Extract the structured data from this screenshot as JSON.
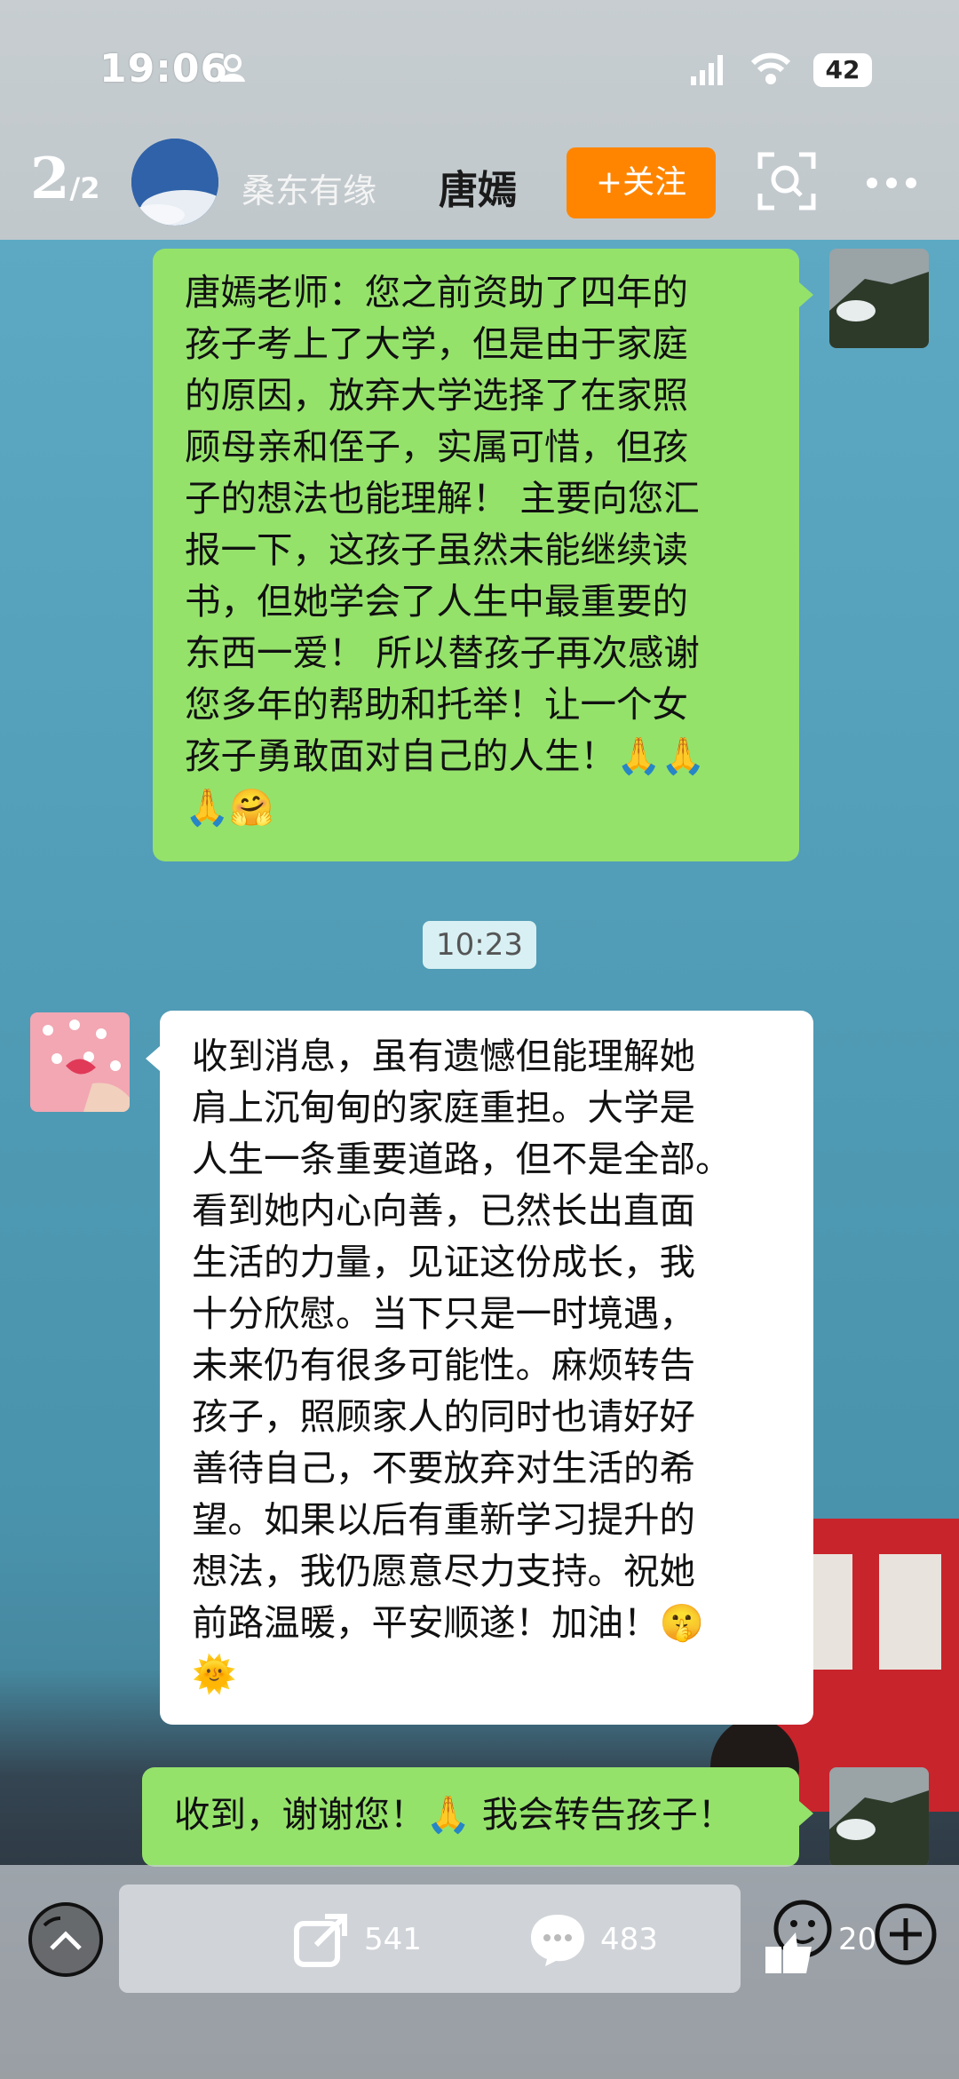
{
  "status_bar": {
    "time": "19:06",
    "battery": "42"
  },
  "header": {
    "page_current": "2",
    "page_total": "/2",
    "channel_name": "桑东有缘",
    "poster_name": "唐嫣",
    "follow_label": "+关注"
  },
  "chat": {
    "message_1_lines": [
      "唐嫣老师：您之前资助了四年的",
      "孩子考上了大学，但是由于家庭",
      "的原因，放弃大学选择了在家照",
      "顾母亲和侄子，实属可惜，但孩",
      "子的想法也能理解！ 主要向您汇",
      "报一下，这孩子虽然未能继续读",
      "书，但她学会了人生中最重要的",
      "东西一爱！ 所以替孩子再次感谢",
      "您多年的帮助和托举！让一个女",
      "孩子勇敢面对自己的人生！🙏🙏",
      "🙏🤗"
    ],
    "timestamp": "10:23",
    "message_2_lines": [
      "收到消息，虽有遗憾但能理解她",
      "肩上沉甸甸的家庭重担。大学是",
      "人生一条重要道路，但不是全部。",
      "看到她内心向善，已然长出直面",
      "生活的力量，见证这份成长，我",
      "十分欣慰。当下只是一时境遇，",
      "未来仍有很多可能性。麻烦转告",
      "孩子，照顾家人的同时也请好好",
      "善待自己，不要放弃对生活的希",
      "望。如果以后有重新学习提升的",
      "想法，我仍愿意尽力支持。祝她",
      "前路温暖，平安顺遂！加油！🤫",
      "🌞"
    ],
    "message_3": "收到，谢谢您！🙏 我会转告孩子！"
  },
  "bottom_bar": {
    "share_count": "541",
    "comment_count": "483",
    "like_count": "20"
  }
}
